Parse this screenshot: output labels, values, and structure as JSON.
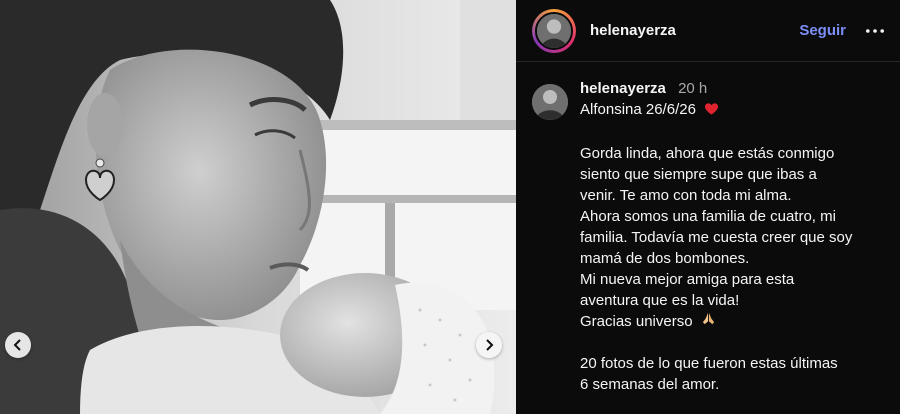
{
  "post": {
    "prev_icon": "chevron-left-icon",
    "next_icon": "chevron-right-icon"
  },
  "header": {
    "username": "helenayerza",
    "follow_label": "Seguir",
    "more_icon": "more-icon"
  },
  "caption": {
    "username": "helenayerza",
    "time": "20 h",
    "title": "Alfonsina 26/6/26",
    "heart": "❤️",
    "lines": [
      "Gorda linda, ahora que estás conmigo",
      "siento que siempre supe que ibas a",
      "venir. Te amo con toda mi alma.",
      "Ahora somos una familia de cuatro, mi",
      "familia. Todavía me cuesta creer que soy",
      "mamá de dos bombones.",
      "Mi nueva mejor amiga para esta",
      "aventura que es la vida!",
      "Gracias universo"
    ],
    "pray": "🙏",
    "footer_lines": [
      "20 fotos de lo que fueron estas últimas",
      "6 semanas del amor."
    ]
  },
  "colors": {
    "follow": "#7b8ff7",
    "background": "#0b0b0b"
  }
}
